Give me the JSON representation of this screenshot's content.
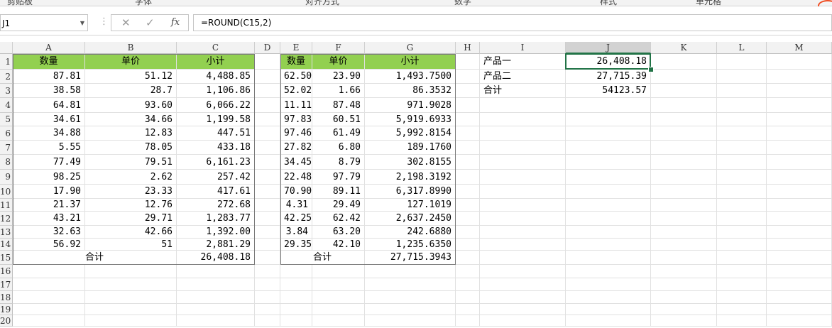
{
  "ribbon_groups": [
    "剪贴板",
    "字体",
    "对齐方式",
    "数字",
    "样式",
    "单元格"
  ],
  "name_box": "J1",
  "formula": "=ROUND(C15,2)",
  "formula_buttons": {
    "cancel": "✕",
    "enter": "✓",
    "fx": "fx"
  },
  "columns": [
    "A",
    "B",
    "C",
    "D",
    "E",
    "F",
    "G",
    "H",
    "I",
    "J",
    "K",
    "L",
    "M"
  ],
  "selected_column": "J",
  "rows": [
    "1",
    "2",
    "3",
    "4",
    "5",
    "6",
    "7",
    "8",
    "9",
    "10",
    "11",
    "12",
    "13",
    "14",
    "15",
    "16",
    "17",
    "18",
    "19",
    "20"
  ],
  "table1": {
    "headers": [
      "数量",
      "单价",
      "小计"
    ],
    "rows": [
      [
        "87.81",
        "51.12",
        "4,488.85"
      ],
      [
        "38.58",
        "28.7",
        "1,106.86"
      ],
      [
        "64.81",
        "93.60",
        "6,066.22"
      ],
      [
        "34.61",
        "34.66",
        "1,199.58"
      ],
      [
        "34.88",
        "12.83",
        "447.51"
      ],
      [
        "5.55",
        "78.05",
        "433.18"
      ],
      [
        "77.49",
        "79.51",
        "6,161.23"
      ],
      [
        "98.25",
        "2.62",
        "257.42"
      ],
      [
        "17.90",
        "23.33",
        "417.61"
      ],
      [
        "21.37",
        "12.76",
        "272.68"
      ],
      [
        "43.21",
        "29.71",
        "1,283.77"
      ],
      [
        "32.63",
        "42.66",
        "1,392.00"
      ],
      [
        "56.92",
        "51",
        "2,881.29"
      ]
    ],
    "total_label": "合计",
    "total": "26,408.18"
  },
  "table2": {
    "headers": [
      "数量",
      "单价",
      "小计"
    ],
    "rows": [
      [
        "62.50",
        "23.90",
        "1,493.7500"
      ],
      [
        "52.02",
        "1.66",
        "86.3532"
      ],
      [
        "11.11",
        "87.48",
        "971.9028"
      ],
      [
        "97.83",
        "60.51",
        "5,919.6933"
      ],
      [
        "97.46",
        "61.49",
        "5,992.8154"
      ],
      [
        "27.82",
        "6.80",
        "189.1760"
      ],
      [
        "34.45",
        "8.79",
        "302.8155"
      ],
      [
        "22.48",
        "97.79",
        "2,198.3192"
      ],
      [
        "70.90",
        "89.11",
        "6,317.8990"
      ],
      [
        "4.31",
        "29.49",
        "127.1019"
      ],
      [
        "42.25",
        "62.42",
        "2,637.2450"
      ],
      [
        "3.84",
        "63.20",
        "242.6880"
      ],
      [
        "29.35",
        "42.10",
        "1,235.6350"
      ]
    ],
    "total_label": "合计",
    "total": "27,715.3943"
  },
  "summary": [
    {
      "label": "产品一",
      "value": "26,408.18"
    },
    {
      "label": "产品二",
      "value": "27,715.39"
    },
    {
      "label": "合计",
      "value": "54123.57"
    }
  ]
}
